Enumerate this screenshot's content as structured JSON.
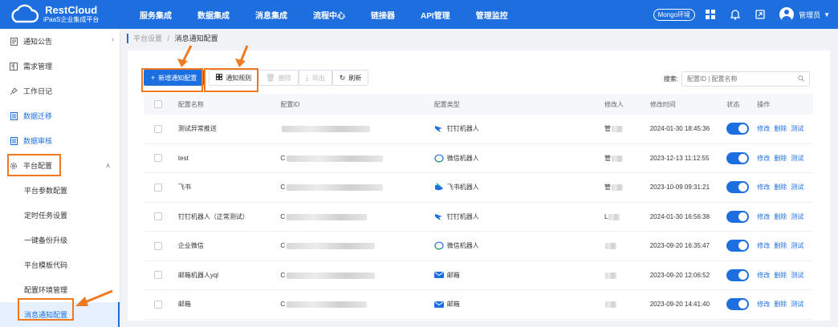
{
  "header": {
    "brand_title": "RestCloud",
    "brand_subtitle": "iPaaS企业集成平台",
    "nav": [
      "服务集成",
      "数据集成",
      "消息集成",
      "流程中心",
      "链接器",
      "API管理",
      "管理监控"
    ],
    "env_label": "Mongo环境",
    "user_label": "管理员"
  },
  "sidebar": {
    "items": [
      {
        "label": "通知公告",
        "icon": "document-icon"
      },
      {
        "label": "需求管理",
        "icon": "book-icon"
      },
      {
        "label": "工作日记",
        "icon": "pin-icon"
      },
      {
        "label": "数据迁移",
        "icon": "list-icon"
      },
      {
        "label": "数据审核",
        "icon": "list-icon"
      },
      {
        "label": "平台配置",
        "icon": "gear-icon"
      }
    ],
    "subitems": [
      "平台参数配置",
      "定时任务设置",
      "一键备份升级",
      "平台模板代码",
      "配置环境管理",
      "消息通知配置"
    ],
    "collapse_label": "‹"
  },
  "breadcrumb": {
    "parent": "平台设置",
    "sep": "/",
    "current": "消息通知配置"
  },
  "toolbar": {
    "add_label": "新增通知配置",
    "rules_label": "通知规则",
    "delete_label": "删除",
    "export_label": "导出",
    "refresh_label": "刷新"
  },
  "search": {
    "label": "搜索:",
    "placeholder": "配置ID | 配置名称"
  },
  "table": {
    "columns": [
      "配置名称",
      "配置ID",
      "配置类型",
      "修改人",
      "修改时间",
      "状态",
      "操作"
    ],
    "rows": [
      {
        "name": "测试异常推送",
        "id_visible": "",
        "type": "钉钉机器人",
        "type_icon": "dingtalk-icon",
        "modifier": "管",
        "time": "2024-01-30 18:45:36"
      },
      {
        "name": "test",
        "id_visible": "C",
        "type": "微信机器人",
        "type_icon": "wechat-icon",
        "modifier": "管",
        "time": "2023-12-13 11:12:55"
      },
      {
        "name": "飞书",
        "id_visible": "C",
        "type": "飞书机器人",
        "type_icon": "feishu-icon",
        "modifier": "管",
        "time": "2023-10-09 09:31:21"
      },
      {
        "name": "钉钉机器人（正常测试）",
        "id_visible": "C",
        "type": "钉钉机器人",
        "type_icon": "dingtalk-icon",
        "modifier": "L",
        "time": "2024-01-30 16:56:38"
      },
      {
        "name": "企业微信",
        "id_visible": "C",
        "type": "微信机器人",
        "type_icon": "wechat-icon",
        "modifier": "",
        "time": "2023-09-20 16:35:47"
      },
      {
        "name": "邮箱机器人yql",
        "id_visible": "C",
        "type": "邮箱",
        "type_icon": "mail-icon",
        "modifier": "",
        "time": "2023-09-20 12:06:52"
      },
      {
        "name": "邮箱",
        "id_visible": "C",
        "type": "邮箱",
        "type_icon": "mail-icon",
        "modifier": "",
        "time": "2023-09-20 14:41:40"
      }
    ],
    "actions": [
      "修改",
      "删除",
      "测试"
    ]
  },
  "colors": {
    "primary": "#1d6fe0",
    "highlight": "#f07a22"
  }
}
